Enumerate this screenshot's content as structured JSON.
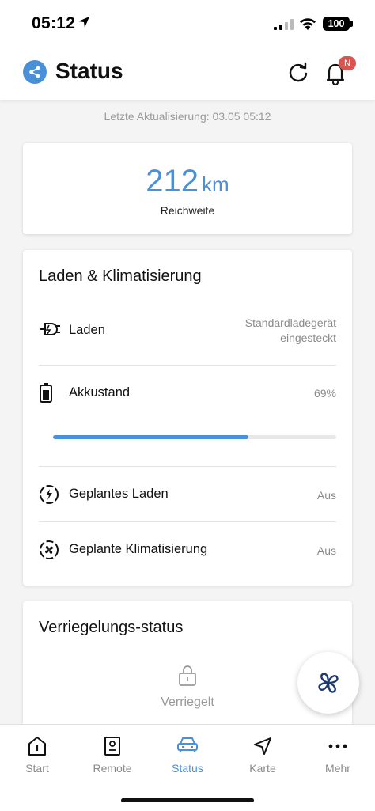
{
  "status_bar": {
    "time": "05:12",
    "battery": "100"
  },
  "header": {
    "title": "Status",
    "notification_badge": "N"
  },
  "last_update": "Letzte Aktualisierung: 03.05 05:12",
  "range": {
    "value": "212",
    "unit": "km",
    "label": "Reichweite"
  },
  "charging": {
    "title": "Laden & Klimatisierung",
    "rows": [
      {
        "label": "Laden",
        "value_line1": "Standardladegerät",
        "value_line2": "eingesteckt",
        "icon": "plug-icon"
      },
      {
        "label": "Akkustand",
        "value": "69%",
        "icon": "battery-icon",
        "progress": 0.69
      },
      {
        "label": "Geplantes Laden",
        "value": "Aus",
        "icon": "scheduled-charge-icon"
      },
      {
        "label": "Geplante Klimatisierung",
        "value": "Aus",
        "icon": "scheduled-climate-icon"
      }
    ]
  },
  "lock": {
    "title": "Verriegelungs-status",
    "state": "Verriegelt"
  },
  "nav": {
    "items": [
      {
        "label": "Start",
        "icon": "start-icon"
      },
      {
        "label": "Remote",
        "icon": "remote-icon"
      },
      {
        "label": "Status",
        "icon": "car-icon",
        "active": true
      },
      {
        "label": "Karte",
        "icon": "navigation-icon"
      },
      {
        "label": "Mehr",
        "icon": "more-icon"
      }
    ]
  },
  "colors": {
    "accent": "#4a90d9",
    "badge": "#d9534f",
    "fan": "#1f3b6b"
  }
}
